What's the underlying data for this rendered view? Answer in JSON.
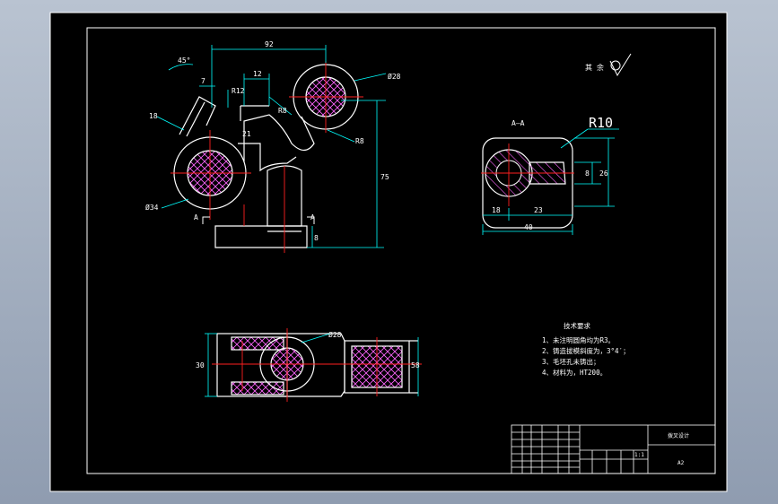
{
  "drawing": {
    "colors": {
      "viewport_bg": "#9aa6b8",
      "paper": "#000000",
      "frame": "#ffffff",
      "outline": "#ffffff",
      "dimension": "#00ffff",
      "centerline": "#ff2020",
      "hatch": "#ff66ff",
      "text": "#ffffff"
    },
    "dimensions": {
      "top_width": "92",
      "slot": "12",
      "small": "7",
      "left_offset": "18",
      "angle": "45°",
      "inner_width": "R12",
      "mid_depth": "21",
      "bore_top": "Ø28",
      "bore_left": "Ø34",
      "fillet": "R8",
      "overall_height": "75",
      "base_height": "8",
      "arm": "R8",
      "side_w1": "18",
      "side_w2": "23",
      "side_total": "40",
      "side_h1": "8",
      "side_h2": "26",
      "front_h": "30",
      "front_right_h": "58",
      "front_bore": "Ø28"
    },
    "labels": {
      "section_a": "A",
      "section_title": "A—A",
      "radius_r10": "R10",
      "roughness_note": "其 余"
    },
    "notes": {
      "title": "技术要求",
      "items": [
        "1、未注明圆角均为R3。",
        "2、铸造拔模斜度为，3°4′；",
        "3、毛坯孔未铸出；",
        "4、材料为，HT200。"
      ]
    },
    "title_block": {
      "part_name": "拨叉设计",
      "scale": "1:1",
      "sheet": "A2"
    }
  }
}
